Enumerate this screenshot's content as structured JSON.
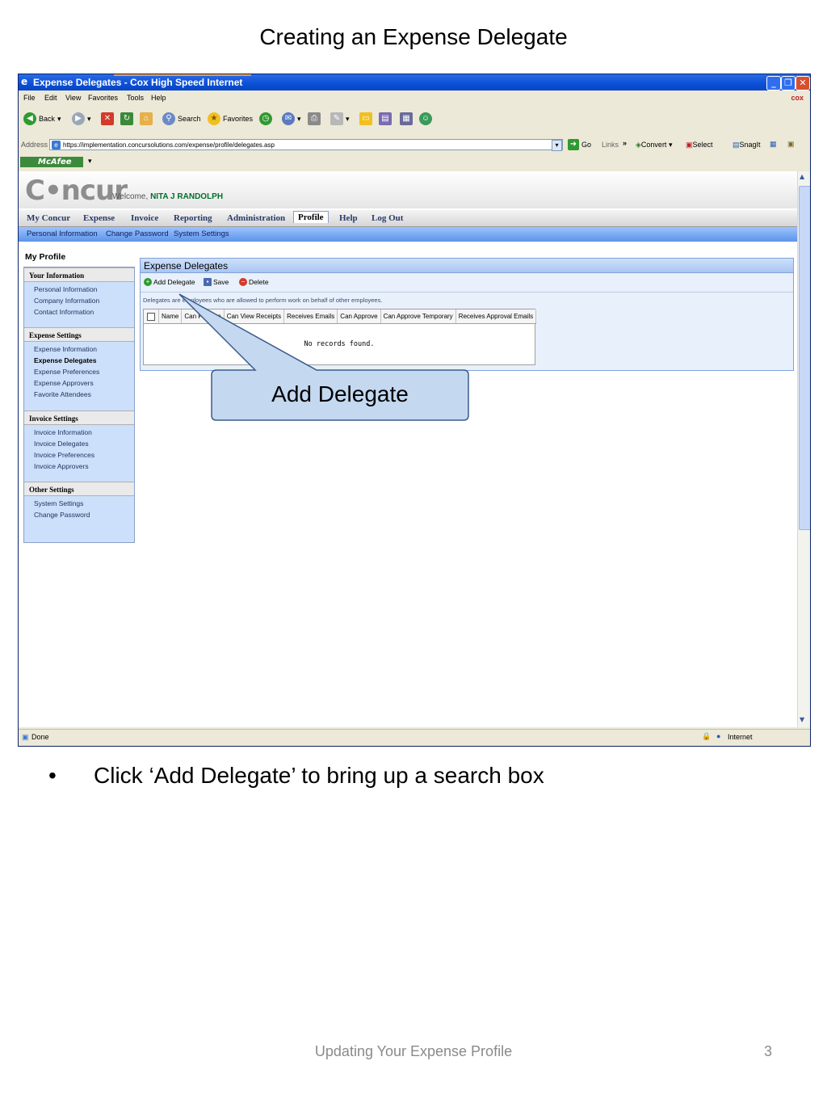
{
  "slide": {
    "title": "Creating an Expense Delegate",
    "callout": "Add Delegate",
    "bullet_marker": "•",
    "bullet": "Click  ‘Add Delegate’ to bring up a search box",
    "footer": "Updating Your Expense Profile",
    "page_number": "3"
  },
  "browser": {
    "window_title": "Expense Delegates - Cox High Speed Internet",
    "menu": [
      "File",
      "Edit",
      "View",
      "Favorites",
      "Tools",
      "Help"
    ],
    "brand": "cox",
    "toolbar": {
      "back": "Back",
      "search": "Search",
      "favorites": "Favorites"
    },
    "address_label": "Address",
    "address_url": "https://implementation.concursolutions.com/expense/profile/delegates.asp",
    "go": "Go",
    "links": "Links",
    "convert": "Convert",
    "select": "Select",
    "snagit": "SnagIt",
    "mcafee": "McAfee",
    "status_text": "Done",
    "status_zone": "Internet"
  },
  "concur": {
    "logo": "C•ncur",
    "welcome_prefix": "Welcome,",
    "user_name": "NITA J RANDOLPH",
    "nav": [
      "My Concur",
      "Expense",
      "Invoice",
      "Reporting",
      "Administration",
      "Profile",
      "Help",
      "Log Out"
    ],
    "subnav": [
      "Personal Information",
      "Change Password",
      "System Settings"
    ],
    "my_profile": "My Profile",
    "sidebar": {
      "your_information": {
        "title": "Your Information",
        "items": [
          "Personal Information",
          "Company Information",
          "Contact Information"
        ]
      },
      "expense_settings": {
        "title": "Expense Settings",
        "items": [
          "Expense Information",
          "Expense Delegates",
          "Expense Preferences",
          "Expense Approvers",
          "Favorite Attendees"
        ]
      },
      "invoice_settings": {
        "title": "Invoice Settings",
        "items": [
          "Invoice Information",
          "Invoice Delegates",
          "Invoice Preferences",
          "Invoice Approvers"
        ]
      },
      "other_settings": {
        "title": "Other Settings",
        "items": [
          "System Settings",
          "Change Password"
        ]
      }
    },
    "panel": {
      "title": "Expense Delegates",
      "add": "Add Delegate",
      "save": "Save",
      "delete": "Delete",
      "description": "Delegates are employees who are allowed to perform work on behalf of other employees.",
      "columns": [
        "Name",
        "Can Prepare",
        "Can View Receipts",
        "Receives Emails",
        "Can Approve",
        "Can Approve Temporary",
        "Receives Approval Emails"
      ],
      "empty": "No records found."
    }
  }
}
